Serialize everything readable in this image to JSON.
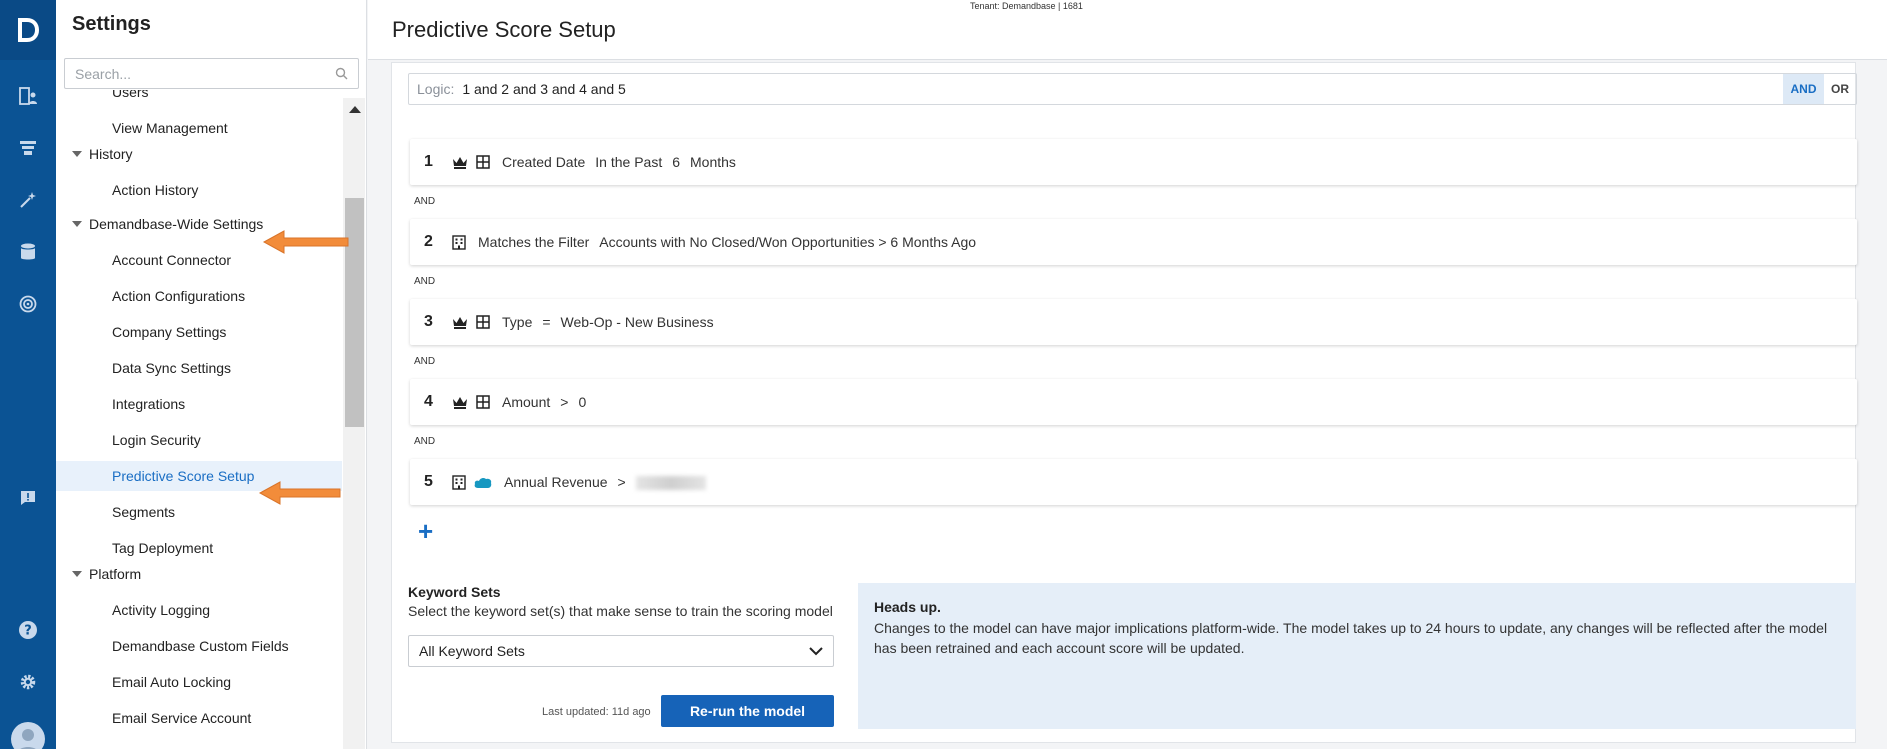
{
  "tenant": "Tenant: Demandbase | 1681",
  "rail": {
    "logo": "D",
    "icons": [
      "accounts-icon",
      "funnel-icon",
      "magic-wand-icon",
      "database-icon",
      "target-icon",
      "feedback-icon",
      "help-icon",
      "gear-icon",
      "avatar"
    ]
  },
  "settings": {
    "title": "Settings",
    "search_placeholder": "Search...",
    "items": [
      {
        "label": "Users",
        "kind": "sub"
      },
      {
        "label": "View Management",
        "kind": "sub"
      },
      {
        "label": "History",
        "kind": "group"
      },
      {
        "label": "Action History",
        "kind": "sub"
      },
      {
        "label": "Demandbase-Wide Settings",
        "kind": "group"
      },
      {
        "label": "Account Connector",
        "kind": "sub"
      },
      {
        "label": "Action Configurations",
        "kind": "sub"
      },
      {
        "label": "Company Settings",
        "kind": "sub"
      },
      {
        "label": "Data Sync Settings",
        "kind": "sub"
      },
      {
        "label": "Integrations",
        "kind": "sub"
      },
      {
        "label": "Login Security",
        "kind": "sub"
      },
      {
        "label": "Predictive Score Setup",
        "kind": "sub",
        "active": true
      },
      {
        "label": "Segments",
        "kind": "sub"
      },
      {
        "label": "Tag Deployment",
        "kind": "sub"
      },
      {
        "label": "Platform",
        "kind": "group"
      },
      {
        "label": "Activity Logging",
        "kind": "sub"
      },
      {
        "label": "Demandbase Custom Fields",
        "kind": "sub"
      },
      {
        "label": "Email Auto Locking",
        "kind": "sub"
      },
      {
        "label": "Email Service Account",
        "kind": "sub"
      }
    ]
  },
  "main": {
    "title": "Predictive Score Setup",
    "logic": {
      "label": "Logic:",
      "value": "1 and 2 and 3 and 4 and 5",
      "and_btn": "AND",
      "or_btn": "OR"
    },
    "connector": "AND",
    "rules": [
      {
        "num": "1",
        "icons": [
          "crown-icon",
          "grid-icon"
        ],
        "parts": [
          "Created Date",
          "In the Past",
          "6",
          "Months"
        ]
      },
      {
        "num": "2",
        "icons": [
          "building-icon"
        ],
        "parts": [
          "Matches the Filter",
          "Accounts with No Closed/Won Opportunities > 6 Months Ago"
        ]
      },
      {
        "num": "3",
        "icons": [
          "crown-icon",
          "grid-icon"
        ],
        "parts": [
          "Type",
          "=",
          "Web-Op - New Business"
        ]
      },
      {
        "num": "4",
        "icons": [
          "crown-icon",
          "grid-icon"
        ],
        "parts": [
          "Amount",
          ">",
          "0"
        ]
      },
      {
        "num": "5",
        "icons": [
          "building-icon",
          "salesforce-cloud-icon"
        ],
        "parts": [
          "Annual Revenue",
          ">"
        ],
        "blurred": true
      }
    ],
    "add_label": "+",
    "keyword_sets": {
      "title": "Keyword Sets",
      "description": "Select the keyword set(s) that make sense to train the scoring model",
      "selected": "All Keyword Sets"
    },
    "last_updated": "Last updated: 11d ago",
    "rerun_label": "Re-run the model",
    "heads_up": {
      "title": "Heads up.",
      "body": "Changes to the model can have major implications platform-wide. The model takes up to 24 hours to update, any changes will be reflected after the model has been retrained and each account score will be updated."
    }
  },
  "colors": {
    "rail": "#0b5394",
    "accent": "#1a6ec4",
    "button": "#1663b8",
    "callout": "#e5eef8",
    "arrow": "#f28c3a"
  }
}
